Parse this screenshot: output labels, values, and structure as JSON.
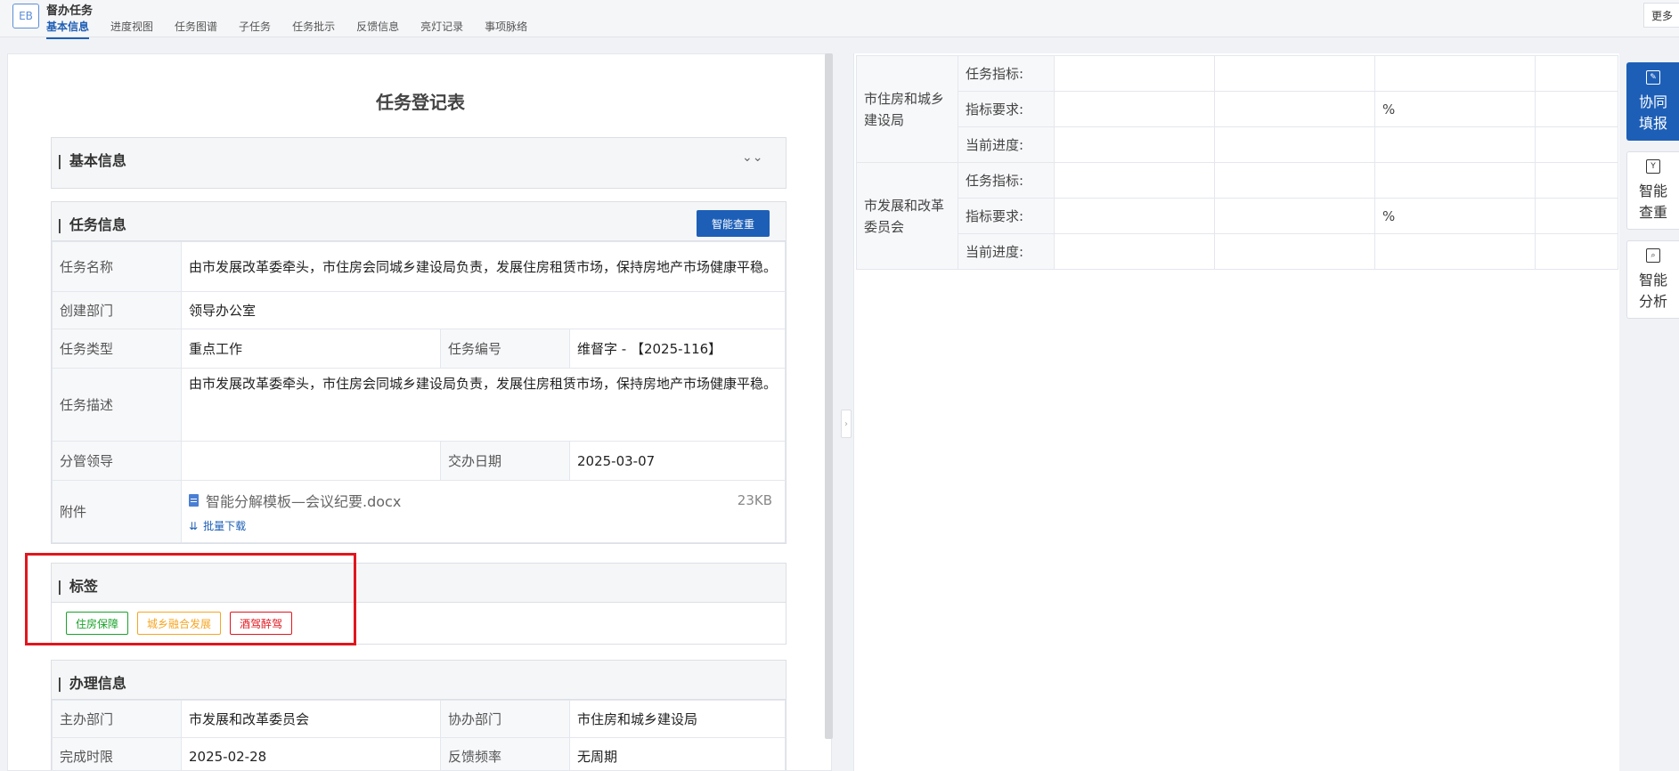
{
  "app": {
    "badge": "EB",
    "title": "督办任务",
    "more_label": "更多"
  },
  "tabs": [
    "基本信息",
    "进度视图",
    "任务图谱",
    "子任务",
    "任务批示",
    "反馈信息",
    "亮灯记录",
    "事项脉络"
  ],
  "form": {
    "title": "任务登记表",
    "basic_section": "基本信息",
    "task_section": "任务信息",
    "dedupe_button": "智能查重",
    "rows": {
      "task_name_label": "任务名称",
      "task_name": "由市发展改革委牵头，市住房会同城乡建设局负责，发展住房租赁市场，保持房地产市场健康平稳。",
      "creator_dept_label": "创建部门",
      "creator_dept": "领导办公室",
      "task_type_label": "任务类型",
      "task_type": "重点工作",
      "task_no_label": "任务编号",
      "task_no": "维督字 - 【2025-116】",
      "task_desc_label": "任务描述",
      "task_desc": "由市发展改革委牵头，市住房会同城乡建设局负责，发展住房租赁市场，保持房地产市场健康平稳。",
      "leader_label": "分管领导",
      "leader": "",
      "assign_date_label": "交办日期",
      "assign_date": "2025-03-07",
      "attachment_label": "附件",
      "attachment_name": "智能分解模板—会议纪要.docx",
      "attachment_size": "23KB",
      "batch_download": "批量下载"
    },
    "tags_section": "标签",
    "tags": [
      {
        "label": "住房保障",
        "color": "#1aa32a"
      },
      {
        "label": "城乡融合发展",
        "color": "#f5a623"
      },
      {
        "label": "酒驾醉驾",
        "color": "#e0161e"
      }
    ],
    "handling_section": "办理信息",
    "handling": {
      "lead_dept_label": "主办部门",
      "lead_dept": "市发展和改革委员会",
      "co_dept_label": "协办部门",
      "co_dept": "市住房和城乡建设局",
      "deadline_label": "完成时限",
      "deadline": "2025-02-28",
      "freq_label": "反馈频率",
      "freq": "无周期"
    }
  },
  "indicators": [
    {
      "dept": "市住房和城乡建设局",
      "rows": [
        "任务指标:",
        "指标要求:",
        "当前进度:"
      ],
      "pct": "%"
    },
    {
      "dept": "市发展和改革委员会",
      "rows": [
        "任务指标:",
        "指标要求:",
        "当前进度:"
      ],
      "pct": "%"
    }
  ],
  "side_tools": [
    {
      "label": "协同填报",
      "icon": "edit-icon"
    },
    {
      "label": "智能查重",
      "icon": "filter-icon"
    },
    {
      "label": "智能分析",
      "icon": "analysis-icon"
    }
  ]
}
